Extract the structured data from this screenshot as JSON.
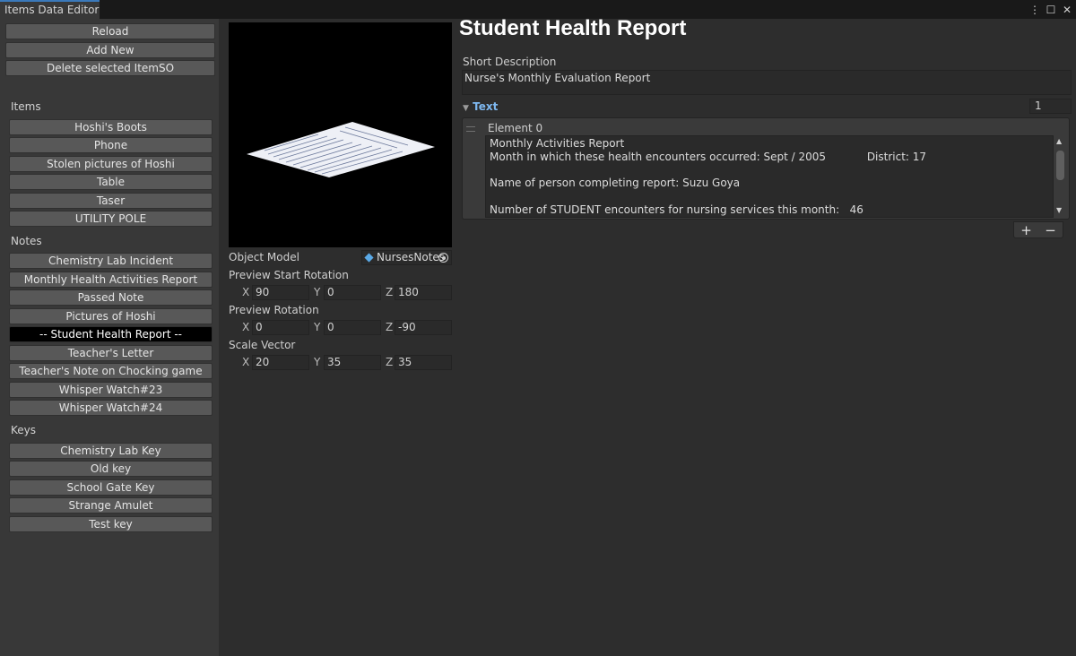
{
  "window": {
    "tab_title": "Items Data Editor",
    "icons": [
      "menu-dots-icon",
      "maximize-icon",
      "close-icon"
    ]
  },
  "left_panel": {
    "actions": [
      "Reload",
      "Add New",
      "Delete selected ItemSO"
    ],
    "sections": [
      {
        "label": "Items",
        "items": [
          "Hoshi's Boots",
          "Phone",
          "Stolen pictures of Hoshi",
          "Table",
          "Taser",
          "UTILITY POLE"
        ]
      },
      {
        "label": "Notes",
        "items": [
          "Chemistry Lab Incident",
          "Monthly Health Activities Report",
          "Passed Note",
          "Pictures of Hoshi",
          "-- Student Health Report --",
          "Teacher's Letter",
          "Teacher's Note on Chocking game",
          "Whisper Watch#23",
          "Whisper Watch#24"
        ]
      },
      {
        "label": "Keys",
        "items": [
          "Chemistry Lab Key",
          "Old key",
          "School Gate Key",
          "Strange Amulet",
          "Test key"
        ]
      }
    ],
    "selected": "-- Student Health Report --"
  },
  "props": {
    "object_model_label": "Object Model",
    "object_model_value": "NursesNotes",
    "preview_start_rotation": {
      "label": "Preview Start Rotation",
      "x": "90",
      "y": "0",
      "z": "180"
    },
    "preview_rotation": {
      "label": "Preview Rotation",
      "x": "0",
      "y": "0",
      "z": "-90"
    },
    "scale_vector": {
      "label": "Scale Vector",
      "x": "20",
      "y": "35",
      "z": "35"
    },
    "axis": {
      "x": "X",
      "y": "Y",
      "z": "Z"
    }
  },
  "detail": {
    "title": "Student Health Report",
    "short_description_label": "Short Description",
    "short_description": "Nurse's Monthly Evaluation Report",
    "text_label": "Text",
    "text_count": "1",
    "element_label": "Element 0",
    "element_text": "Monthly Activities Report\nMonth in which these health encounters occurred: Sept / 2005            District: 17\n\nName of person completing report: Suzu Goya\n\nNumber of STUDENT encounters for nursing services this month:   46",
    "add_label": "+",
    "remove_label": "−"
  }
}
